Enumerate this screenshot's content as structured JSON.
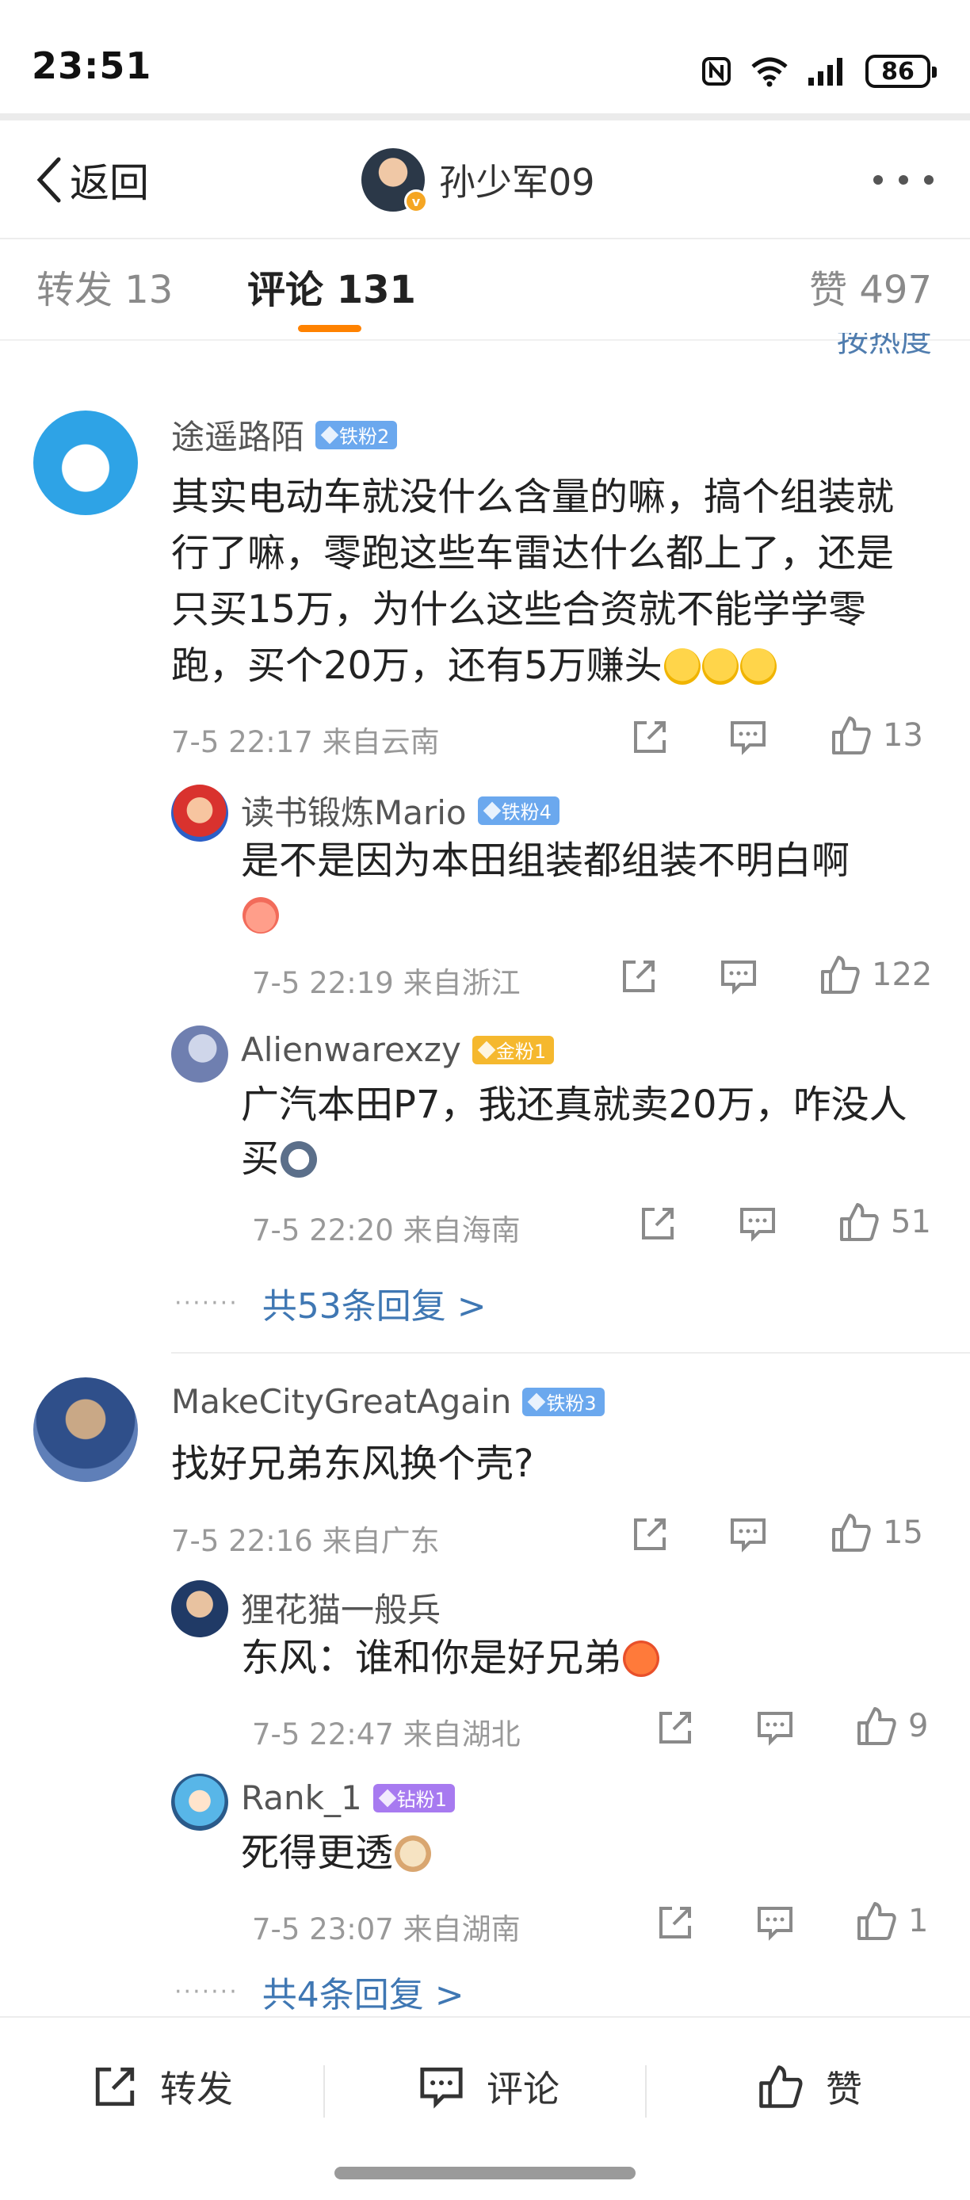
{
  "status_bar": {
    "time": "23:51",
    "battery": "86",
    "icons": [
      "nfc-icon",
      "wifi-icon",
      "signal-icon",
      "battery-icon"
    ]
  },
  "nav": {
    "back_label": "返回",
    "profile_name": "孙少军09",
    "verified_badge": "v"
  },
  "tabs": {
    "forward": "转发 13",
    "comment": "评论 131",
    "like": "赞 497",
    "accent_color": "#ff8200"
  },
  "sort_label": "按热度",
  "comments": [
    {
      "name": "途遥路陌",
      "badge": "铁粉2",
      "text": "其实电动车就没什么含量的嘛，搞个组装就行了嘛，零跑这些车雷达什么都上了，还是只买15万，为什么这些合资就不能学学零跑，买个20万，还有5万赚头",
      "meta": "7-5 22:17 来自云南",
      "likes": "13",
      "replies": [
        {
          "name": "读书锻炼Mario",
          "badge": "铁粉4",
          "text": "是不是因为本田组装都组装不明白啊",
          "meta": "7-5 22:19 来自浙江",
          "likes": "122"
        },
        {
          "name": "Alienwarexzy",
          "badge": "金粉1",
          "text": "广汽本田P7，我还真就卖20万，咋没人买",
          "meta": "7-5 22:20 来自海南",
          "likes": "51"
        }
      ],
      "more_replies": "共53条回复 >"
    },
    {
      "name": "MakeCityGreatAgain",
      "badge": "铁粉3",
      "text": "找好兄弟东风换个壳?",
      "meta": "7-5 22:16 来自广东",
      "likes": "15",
      "replies": [
        {
          "name": "狸花猫一般兵",
          "badge": "",
          "text": "东风：谁和你是好兄弟",
          "meta": "7-5 22:47 来自湖北",
          "likes": "9"
        },
        {
          "name": "Rank_1",
          "badge": "钻粉1",
          "text": "死得更透",
          "meta": "7-5 23:07 来自湖南",
          "likes": "1"
        }
      ],
      "more_replies": "共4条回复 >"
    }
  ],
  "bottom_bar": {
    "forward": "转发",
    "comment": "评论",
    "like": "赞"
  },
  "colors": {
    "link": "#3f77b3",
    "iron_badge": "#6ba8ee",
    "gold_badge": "#f5b82e",
    "diamond_badge": "#a77af0"
  }
}
